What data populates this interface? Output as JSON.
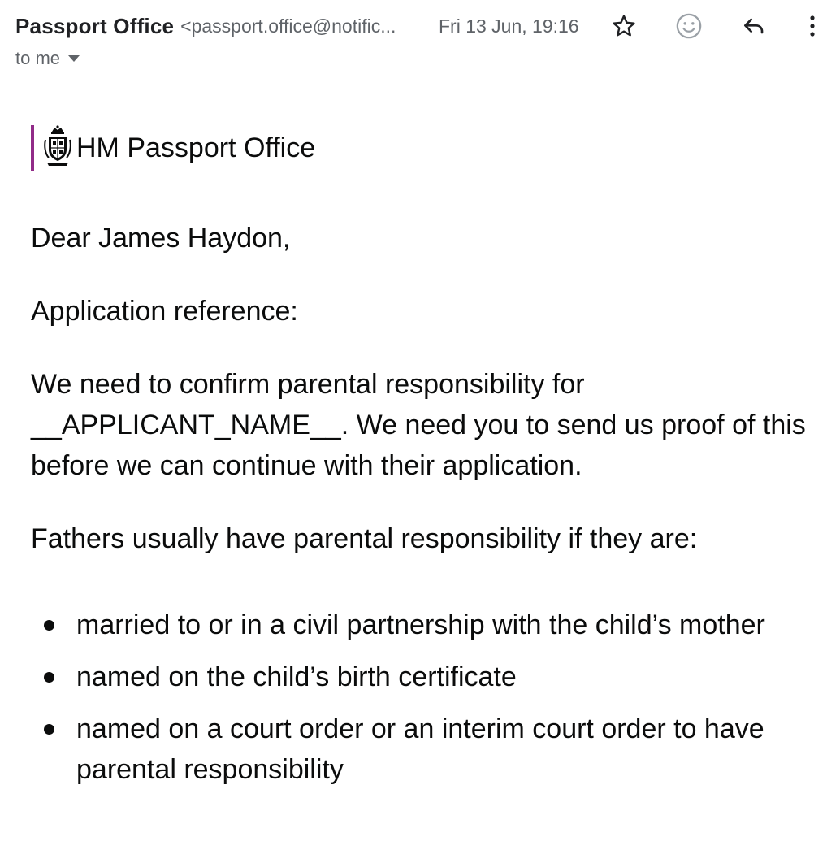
{
  "header": {
    "sender_name": "Passport Office",
    "sender_email": "<passport.office@notific...",
    "date": "Fri 13 Jun, 19:16",
    "recipient": "to me"
  },
  "icons": {
    "star": "star-icon",
    "emoji": "emoji-icon",
    "reply": "reply-icon",
    "more": "more-vertical-icon",
    "crest": "royal-crest-icon"
  },
  "colors": {
    "brand_accent": "#912b88",
    "text": "#0b0c0c",
    "meta": "#5f6368"
  },
  "brand": {
    "name": "HM Passport Office"
  },
  "message": {
    "greeting": "Dear James Haydon,",
    "reference": "Application reference:",
    "paragraph1": "We need to confirm parental responsibility for __APPLICANT_NAME__. We need you to send us proof of this before we can continue with their application.",
    "intro_list": "Fathers usually have parental responsibility if they are:",
    "list": [
      "married to or in a civil partnership with the child’s mother",
      "named on the child’s birth certificate",
      "named on a court order or an interim court order to have parental responsibility"
    ]
  }
}
